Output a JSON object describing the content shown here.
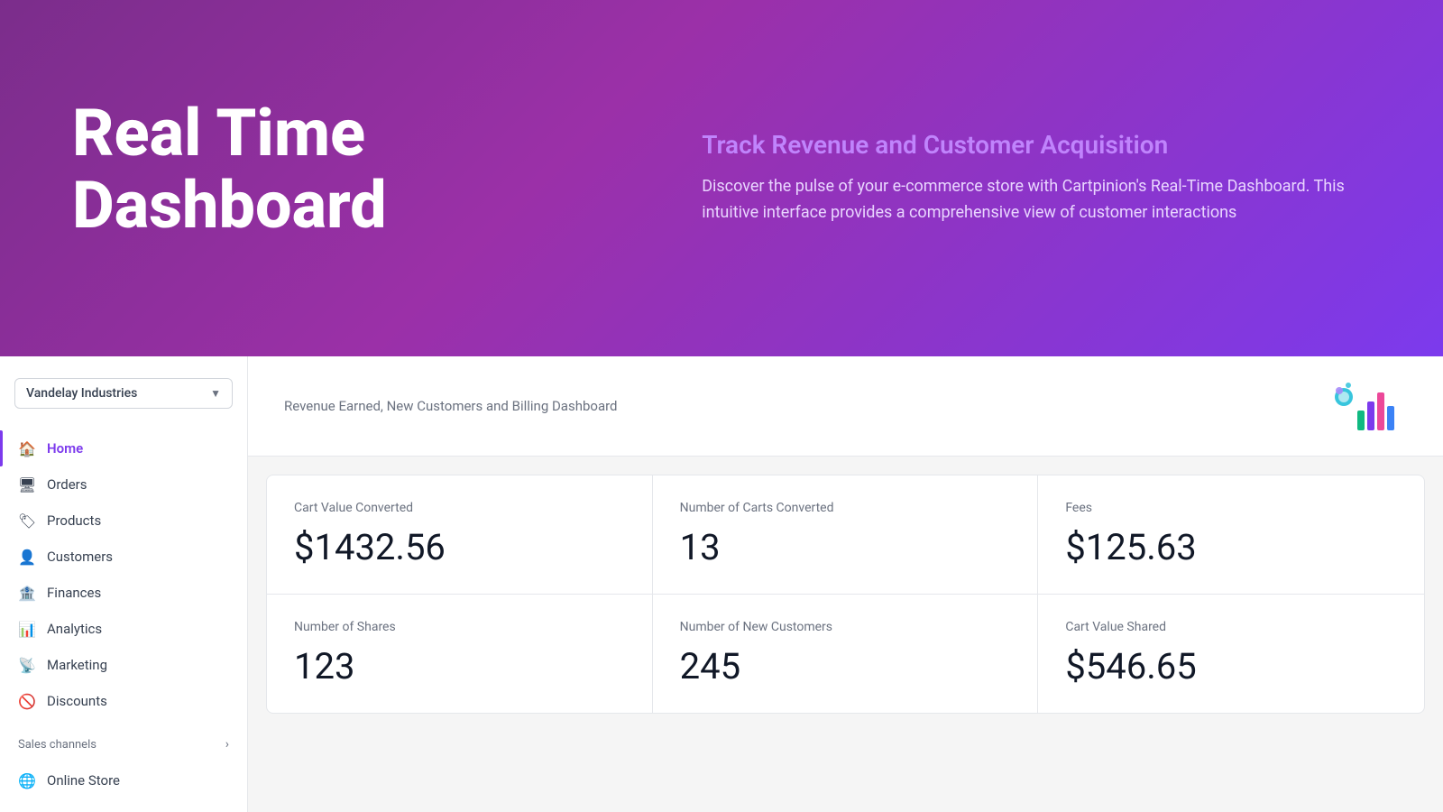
{
  "hero": {
    "title": "Real Time\nDashboard",
    "subtitle": "Track Revenue and Customer Acquisition",
    "description": "Discover the pulse of your e-commerce store with Cartpinion's Real-Time Dashboard. This intuitive interface provides a comprehensive view of customer interactions"
  },
  "sidebar": {
    "store_name": "Vandelay Industries",
    "nav_items": [
      {
        "id": "home",
        "label": "Home",
        "active": true
      },
      {
        "id": "orders",
        "label": "Orders",
        "active": false
      },
      {
        "id": "products",
        "label": "Products",
        "active": false
      },
      {
        "id": "customers",
        "label": "Customers",
        "active": false
      },
      {
        "id": "finances",
        "label": "Finances",
        "active": false
      },
      {
        "id": "analytics",
        "label": "Analytics",
        "active": false
      },
      {
        "id": "marketing",
        "label": "Marketing",
        "active": false
      },
      {
        "id": "discounts",
        "label": "Discounts",
        "active": false
      }
    ],
    "sales_channels_label": "Sales channels"
  },
  "dashboard": {
    "header_text": "Revenue Earned, New Customers and Billing Dashboard",
    "stats": [
      {
        "label": "Cart Value Converted",
        "value": "$1432.56"
      },
      {
        "label": "Number of Carts Converted",
        "value": "13"
      },
      {
        "label": "Fees",
        "value": "$125.63"
      },
      {
        "label": "Number of Shares",
        "value": "123"
      },
      {
        "label": "Number of New Customers",
        "value": "245"
      },
      {
        "label": "Cart Value Shared",
        "value": "$546.65"
      }
    ]
  }
}
